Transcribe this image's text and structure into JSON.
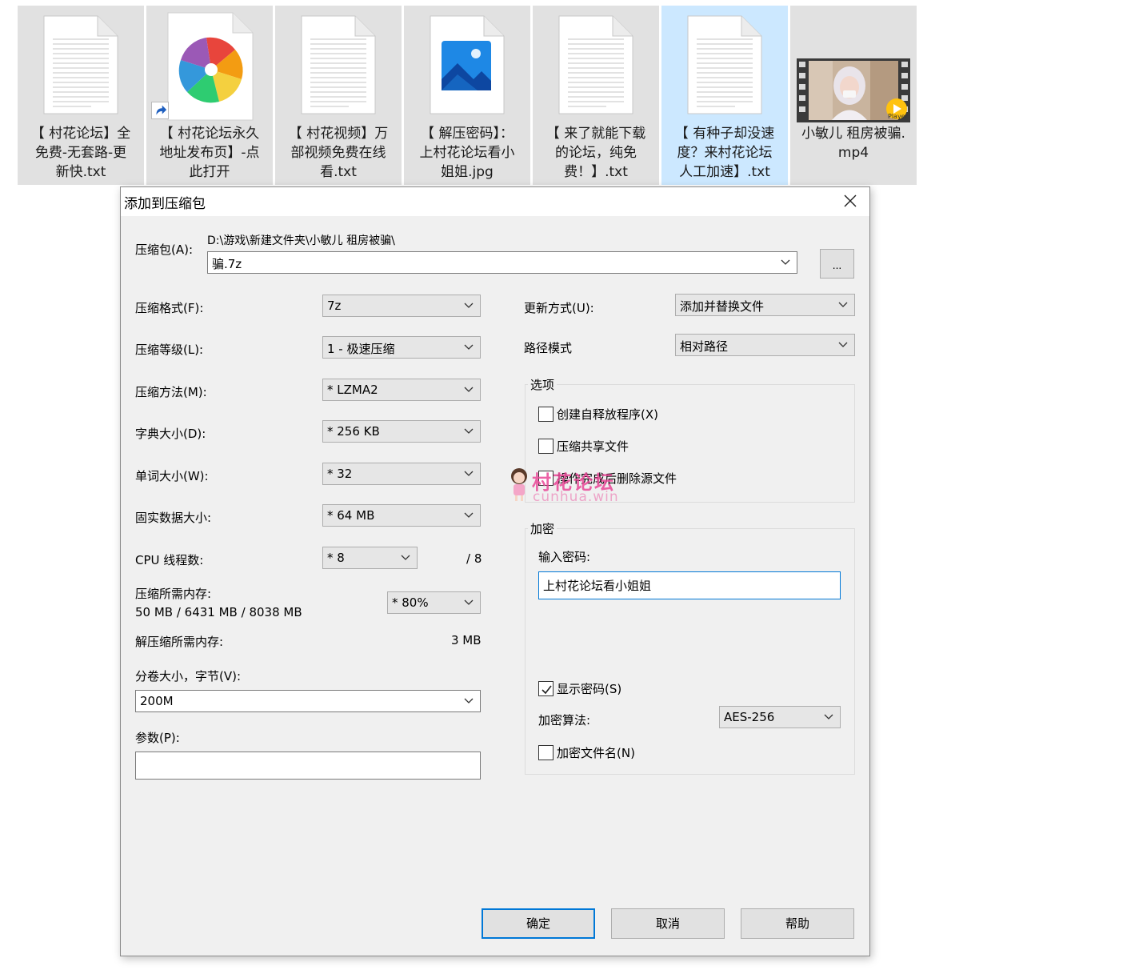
{
  "files": [
    {
      "name": "【 村花论坛】全免费-无套路-更新快.txt",
      "line1": "【 村花论坛】全",
      "line2": "免费-无套路-更",
      "line3": "新快.txt",
      "kind": "text-icon"
    },
    {
      "name": "【 村花论坛永久地址发布页】-点此打开",
      "line1": "【 村花论坛永久",
      "line2": "地址发布页】-点",
      "line3": "此打开",
      "kind": "pinwheel-shortcut-icon"
    },
    {
      "name": "【 村花视频】万部视频免费在线看.txt",
      "line1": "【 村花视频】万",
      "line2": "部视频免费在线",
      "line3": "看.txt",
      "kind": "text-icon"
    },
    {
      "name": "【 解压密码】：上村花论坛看小姐姐.jpg",
      "line1": "【 解压密码】：",
      "line2": "上村花论坛看小",
      "line3": "姐姐.jpg",
      "kind": "image-icon"
    },
    {
      "name": "【 来了就能下载的论坛，纯免费！】.txt",
      "line1": "【 来了就能下载",
      "line2": "的论坛，纯免",
      "line3": "费！】.txt",
      "kind": "text-icon"
    },
    {
      "name": "【 有种子却没速度？来村花论坛人工加速】.txt",
      "line1": "【 有种子却没速",
      "line2": "度？来村花论坛",
      "line3": "人工加速】.txt",
      "kind": "text-icon",
      "selected": true
    },
    {
      "name": "小敏儿 租房被骗.mp4",
      "line1": "小敏儿 租房被骗.",
      "line2": "mp4",
      "line3": "",
      "kind": "video-thumbnail",
      "badge": "Player"
    }
  ],
  "dialog": {
    "title": "添加到压缩包",
    "archive_label": "压缩包(A):",
    "archive_path": "D:\\游戏\\新建文件夹\\小敏儿 租房被骗\\",
    "archive_name": "骗.7z",
    "browse_label": "...",
    "format_label": "压缩格式(F):",
    "format_value": "7z",
    "level_label": "压缩等级(L):",
    "level_value": "1 - 极速压缩",
    "method_label": "压缩方法(M):",
    "method_value": "*  LZMA2",
    "dict_label": "字典大小(D):",
    "dict_value": "*  256 KB",
    "word_label": "单词大小(W):",
    "word_value": "*  32",
    "solid_label": "固实数据大小:",
    "solid_value": "*  64 MB",
    "threads_label": "CPU 线程数:",
    "threads_value": "*  8",
    "threads_total": "/ 8",
    "mem_label": "压缩所需内存:",
    "mem_values": "50 MB / 6431 MB / 8038 MB",
    "mem_percent": "* 80%",
    "decomp_label": "解压缩所需内存:",
    "decomp_value": "3 MB",
    "volume_label": "分卷大小，字节(V):",
    "volume_value": "200M",
    "params_label": "参数(P):",
    "params_value": "",
    "update_label": "更新方式(U):",
    "update_value": "添加并替换文件",
    "pathmode_label": "路径模式",
    "pathmode_value": "相对路径",
    "options_title": "选项",
    "opt_sfx": "创建自释放程序(X)",
    "opt_shared": "压缩共享文件",
    "opt_delete": "操作完成后删除源文件",
    "encrypt_title": "加密",
    "password_label": "输入密码:",
    "password_value": "上村花论坛看小姐姐",
    "show_password": "显示密码(S)",
    "encrypt_method_label": "加密算法:",
    "encrypt_method_value": "AES-256",
    "encrypt_names": "加密文件名(N)",
    "ok": "确定",
    "cancel": "取消",
    "help": "帮助"
  },
  "watermark": {
    "main": "村花论坛",
    "sub": "cunhua.win"
  },
  "colors": {
    "selected_tile": "#cce8ff",
    "tile": "#e1e1e1",
    "focus": "#0078d7",
    "watermark": "#e94696"
  }
}
